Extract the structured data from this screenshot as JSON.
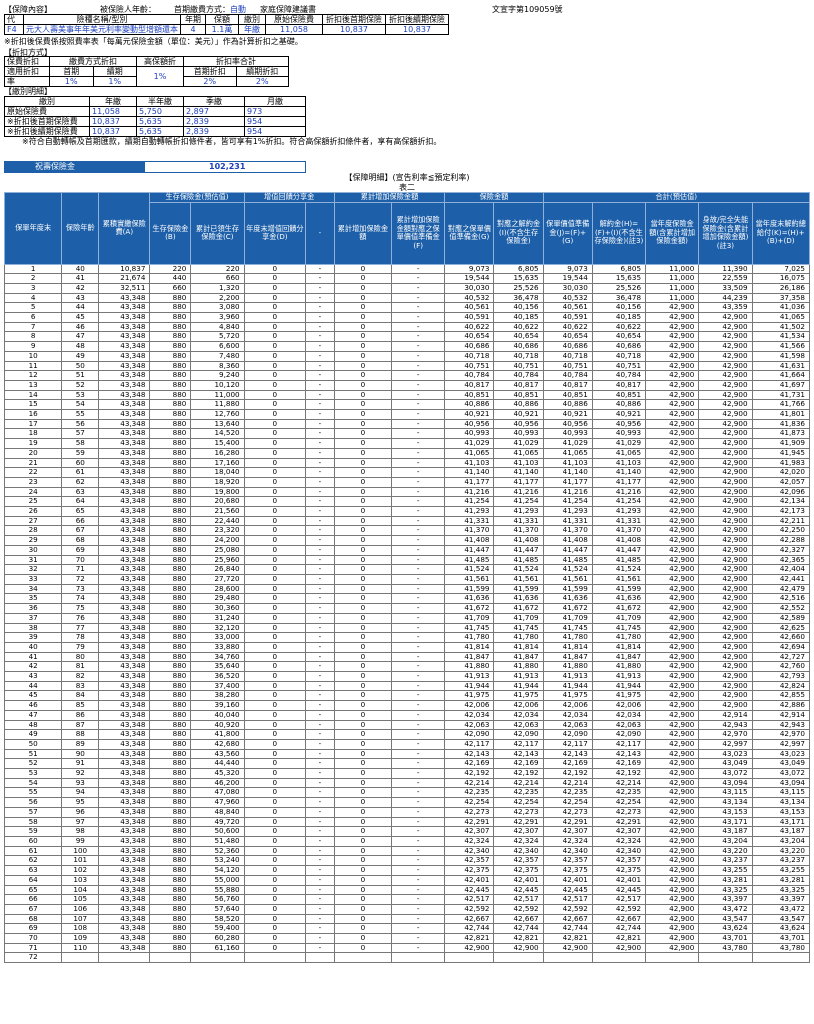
{
  "header": {
    "section_label": "【保障內容】",
    "insured_age_label": "被保險人年齡：",
    "payment_method_label": "首期繳費方式：",
    "payment_method_value": "自動",
    "doc_title": "家庭保障建議書",
    "doc_no": "文宣字第109059號"
  },
  "product_table": {
    "columns": [
      "代",
      "險種名稱/型別",
      "年期",
      "保額",
      "繳別",
      "原始保險費",
      "折扣後首期保險",
      "折扣後續期保險"
    ],
    "row": [
      "F4",
      "元大人壽美事年年美元利率變動型增額還本",
      "4",
      "1.1萬",
      "年繳",
      "11,058",
      "10,837",
      "10,837"
    ]
  },
  "note1": "※折扣後保費係按照費率表「每萬元保險金額（單位：美元）」作為計算折扣之基礎。",
  "discount": {
    "section_label": "【折扣方式】",
    "h_premium": "保費折扣",
    "h_payment": "繳費方式折扣",
    "h_high": "高保額折",
    "h_total": "折扣率合計",
    "r_applicable": "適用折扣",
    "r_rate": "率",
    "first_label": "首期",
    "renew_label": "續期",
    "high_value": "1%",
    "total_first_label": "首期折扣",
    "total_renew_label": "續期折扣",
    "first_value": "1%",
    "renew_value": "1%",
    "total_first_value": "2%",
    "total_renew_value": "2%"
  },
  "payment_detail": {
    "section_label": "【繳別明細】",
    "columns": [
      "繳別",
      "年繳",
      "半年繳",
      "季繳",
      "月繳"
    ],
    "rows": [
      [
        "原始保險費",
        "11,058",
        "5,750",
        "2,897",
        "973"
      ],
      [
        "※折扣後首期保險費",
        "10,837",
        "5,635",
        "2,839",
        "954"
      ],
      [
        "※折扣後續期保險費",
        "10,837",
        "5,635",
        "2,839",
        "954"
      ]
    ]
  },
  "note2": "※符合自動轉帳及首期匯款，續期自動轉帳折扣條件者，皆可享有1%折扣。符合高保額折扣條件者，享有高保額折扣。",
  "celebration": {
    "label": "祝壽保險金",
    "value": "102,231"
  },
  "table_title": "【保障明細】(宣告利率≦預定利率)",
  "table_subtitle": "表二",
  "group_headers": {
    "survival": "生存保險金(預估值)",
    "increase": "增值回饋分享金",
    "cumulative": "累計增加保險金額",
    "insurance": "保險金額",
    "total": "合計(預估值)"
  },
  "columns": [
    "保單年度末",
    "保險年齡",
    "累積實繳保險費(A)",
    "生存保險金(B)",
    "累計已領生存保險金(C)",
    "年度末增值回饋分享金(D)",
    "-",
    "累計增加保險金額",
    "累計增加保險金額對應之保單價值準備金(F)",
    "對應之保單價值準備金(G)",
    "對應之解約金(I)(不含生存保險金)",
    "保單價值準備金(J)=(F)+(G)",
    "解約金(H)=(F)+(I)(不含生存保險金)(註3)",
    "當年度保險金額(含累計增加保險金額)",
    "身故/完全失能保險金(含累計增加保險金額)(註3)",
    "當年度末解約總給付(K)=(H)+(B)+(D)"
  ],
  "rows": [
    [
      1,
      40,
      "10,837",
      220,
      220,
      0,
      0,
      "9,073",
      "6,805",
      "9,073",
      "6,805",
      "11,000",
      "11,390",
      "7,025"
    ],
    [
      2,
      41,
      "21,674",
      440,
      660,
      0,
      0,
      "19,544",
      "15,635",
      "19,544",
      "15,635",
      "11,000",
      "22,559",
      "16,075"
    ],
    [
      3,
      42,
      "32,511",
      660,
      "1,320",
      0,
      0,
      "30,030",
      "25,526",
      "30,030",
      "25,526",
      "11,000",
      "33,509",
      "26,186"
    ],
    [
      4,
      43,
      "43,348",
      880,
      "2,200",
      0,
      0,
      "40,532",
      "36,478",
      "40,532",
      "36,478",
      "11,000",
      "44,239",
      "37,358"
    ],
    [
      5,
      44,
      "43,348",
      880,
      "3,080",
      0,
      0,
      "40,561",
      "40,156",
      "40,561",
      "40,156",
      "42,900",
      "43,359",
      "41,036"
    ],
    [
      6,
      45,
      "43,348",
      880,
      "3,960",
      0,
      0,
      "40,591",
      "40,185",
      "40,591",
      "40,185",
      "42,900",
      "42,900",
      "41,065"
    ],
    [
      7,
      46,
      "43,348",
      880,
      "4,840",
      0,
      0,
      "40,622",
      "40,622",
      "40,622",
      "40,622",
      "42,900",
      "42,900",
      "41,502"
    ],
    [
      8,
      47,
      "43,348",
      880,
      "5,720",
      0,
      0,
      "40,654",
      "40,654",
      "40,654",
      "40,654",
      "42,900",
      "42,900",
      "41,534"
    ],
    [
      9,
      48,
      "43,348",
      880,
      "6,600",
      0,
      0,
      "40,686",
      "40,686",
      "40,686",
      "40,686",
      "42,900",
      "42,900",
      "41,566"
    ],
    [
      10,
      49,
      "43,348",
      880,
      "7,480",
      0,
      0,
      "40,718",
      "40,718",
      "40,718",
      "40,718",
      "42,900",
      "42,900",
      "41,598"
    ],
    [
      11,
      50,
      "43,348",
      880,
      "8,360",
      0,
      0,
      "40,751",
      "40,751",
      "40,751",
      "40,751",
      "42,900",
      "42,900",
      "41,631"
    ],
    [
      12,
      51,
      "43,348",
      880,
      "9,240",
      0,
      0,
      "40,784",
      "40,784",
      "40,784",
      "40,784",
      "42,900",
      "42,900",
      "41,664"
    ],
    [
      13,
      52,
      "43,348",
      880,
      "10,120",
      0,
      0,
      "40,817",
      "40,817",
      "40,817",
      "40,817",
      "42,900",
      "42,900",
      "41,697"
    ],
    [
      14,
      53,
      "43,348",
      880,
      "11,000",
      0,
      0,
      "40,851",
      "40,851",
      "40,851",
      "40,851",
      "42,900",
      "42,900",
      "41,731"
    ],
    [
      15,
      54,
      "43,348",
      880,
      "11,880",
      0,
      0,
      "40,886",
      "40,886",
      "40,886",
      "40,886",
      "42,900",
      "42,900",
      "41,766"
    ],
    [
      16,
      55,
      "43,348",
      880,
      "12,760",
      0,
      0,
      "40,921",
      "40,921",
      "40,921",
      "40,921",
      "42,900",
      "42,900",
      "41,801"
    ],
    [
      17,
      56,
      "43,348",
      880,
      "13,640",
      0,
      0,
      "40,956",
      "40,956",
      "40,956",
      "40,956",
      "42,900",
      "42,900",
      "41,836"
    ],
    [
      18,
      57,
      "43,348",
      880,
      "14,520",
      0,
      0,
      "40,993",
      "40,993",
      "40,993",
      "40,993",
      "42,900",
      "42,900",
      "41,873"
    ],
    [
      19,
      58,
      "43,348",
      880,
      "15,400",
      0,
      0,
      "41,029",
      "41,029",
      "41,029",
      "41,029",
      "42,900",
      "42,900",
      "41,909"
    ],
    [
      20,
      59,
      "43,348",
      880,
      "16,280",
      0,
      0,
      "41,065",
      "41,065",
      "41,065",
      "41,065",
      "42,900",
      "42,900",
      "41,945"
    ],
    [
      21,
      60,
      "43,348",
      880,
      "17,160",
      0,
      0,
      "41,103",
      "41,103",
      "41,103",
      "41,103",
      "42,900",
      "42,900",
      "41,983"
    ],
    [
      22,
      61,
      "43,348",
      880,
      "18,040",
      0,
      0,
      "41,140",
      "41,140",
      "41,140",
      "41,140",
      "42,900",
      "42,900",
      "42,020"
    ],
    [
      23,
      62,
      "43,348",
      880,
      "18,920",
      0,
      0,
      "41,177",
      "41,177",
      "41,177",
      "41,177",
      "42,900",
      "42,900",
      "42,057"
    ],
    [
      24,
      63,
      "43,348",
      880,
      "19,800",
      0,
      0,
      "41,216",
      "41,216",
      "41,216",
      "41,216",
      "42,900",
      "42,900",
      "42,096"
    ],
    [
      25,
      64,
      "43,348",
      880,
      "20,680",
      0,
      0,
      "41,254",
      "41,254",
      "41,254",
      "41,254",
      "42,900",
      "42,900",
      "42,134"
    ],
    [
      26,
      65,
      "43,348",
      880,
      "21,560",
      0,
      0,
      "41,293",
      "41,293",
      "41,293",
      "41,293",
      "42,900",
      "42,900",
      "42,173"
    ],
    [
      27,
      66,
      "43,348",
      880,
      "22,440",
      0,
      0,
      "41,331",
      "41,331",
      "41,331",
      "41,331",
      "42,900",
      "42,900",
      "42,211"
    ],
    [
      28,
      67,
      "43,348",
      880,
      "23,320",
      0,
      0,
      "41,370",
      "41,370",
      "41,370",
      "41,370",
      "42,900",
      "42,900",
      "42,250"
    ],
    [
      29,
      68,
      "43,348",
      880,
      "24,200",
      0,
      0,
      "41,408",
      "41,408",
      "41,408",
      "41,408",
      "42,900",
      "42,900",
      "42,288"
    ],
    [
      30,
      69,
      "43,348",
      880,
      "25,080",
      0,
      0,
      "41,447",
      "41,447",
      "41,447",
      "41,447",
      "42,900",
      "42,900",
      "42,327"
    ],
    [
      31,
      70,
      "43,348",
      880,
      "25,960",
      0,
      0,
      "41,485",
      "41,485",
      "41,485",
      "41,485",
      "42,900",
      "42,900",
      "42,365"
    ],
    [
      32,
      71,
      "43,348",
      880,
      "26,840",
      0,
      0,
      "41,524",
      "41,524",
      "41,524",
      "41,524",
      "42,900",
      "42,900",
      "42,404"
    ],
    [
      33,
      72,
      "43,348",
      880,
      "27,720",
      0,
      0,
      "41,561",
      "41,561",
      "41,561",
      "41,561",
      "42,900",
      "42,900",
      "42,441"
    ],
    [
      34,
      73,
      "43,348",
      880,
      "28,600",
      0,
      0,
      "41,599",
      "41,599",
      "41,599",
      "41,599",
      "42,900",
      "42,900",
      "42,479"
    ],
    [
      35,
      74,
      "43,348",
      880,
      "29,480",
      0,
      0,
      "41,636",
      "41,636",
      "41,636",
      "41,636",
      "42,900",
      "42,900",
      "42,516"
    ],
    [
      36,
      75,
      "43,348",
      880,
      "30,360",
      0,
      0,
      "41,672",
      "41,672",
      "41,672",
      "41,672",
      "42,900",
      "42,900",
      "42,552"
    ],
    [
      37,
      76,
      "43,348",
      880,
      "31,240",
      0,
      0,
      "41,709",
      "41,709",
      "41,709",
      "41,709",
      "42,900",
      "42,900",
      "42,589"
    ],
    [
      38,
      77,
      "43,348",
      880,
      "32,120",
      0,
      0,
      "41,745",
      "41,745",
      "41,745",
      "41,745",
      "42,900",
      "42,900",
      "42,625"
    ],
    [
      39,
      78,
      "43,348",
      880,
      "33,000",
      0,
      0,
      "41,780",
      "41,780",
      "41,780",
      "41,780",
      "42,900",
      "42,900",
      "42,660"
    ],
    [
      40,
      79,
      "43,348",
      880,
      "33,880",
      0,
      0,
      "41,814",
      "41,814",
      "41,814",
      "41,814",
      "42,900",
      "42,900",
      "42,694"
    ],
    [
      41,
      80,
      "43,348",
      880,
      "34,760",
      0,
      0,
      "41,847",
      "41,847",
      "41,847",
      "41,847",
      "42,900",
      "42,900",
      "42,727"
    ],
    [
      42,
      81,
      "43,348",
      880,
      "35,640",
      0,
      0,
      "41,880",
      "41,880",
      "41,880",
      "41,880",
      "42,900",
      "42,900",
      "42,760"
    ],
    [
      43,
      82,
      "43,348",
      880,
      "36,520",
      0,
      0,
      "41,913",
      "41,913",
      "41,913",
      "41,913",
      "42,900",
      "42,900",
      "42,793"
    ],
    [
      44,
      83,
      "43,348",
      880,
      "37,400",
      0,
      0,
      "41,944",
      "41,944",
      "41,944",
      "41,944",
      "42,900",
      "42,900",
      "42,824"
    ],
    [
      45,
      84,
      "43,348",
      880,
      "38,280",
      0,
      0,
      "41,975",
      "41,975",
      "41,975",
      "41,975",
      "42,900",
      "42,900",
      "42,855"
    ],
    [
      46,
      85,
      "43,348",
      880,
      "39,160",
      0,
      0,
      "42,006",
      "42,006",
      "42,006",
      "42,006",
      "42,900",
      "42,900",
      "42,886"
    ],
    [
      47,
      86,
      "43,348",
      880,
      "40,040",
      0,
      0,
      "42,034",
      "42,034",
      "42,034",
      "42,034",
      "42,900",
      "42,914",
      "42,914"
    ],
    [
      48,
      87,
      "43,348",
      880,
      "40,920",
      0,
      0,
      "42,063",
      "42,063",
      "42,063",
      "42,063",
      "42,900",
      "42,943",
      "42,943"
    ],
    [
      49,
      88,
      "43,348",
      880,
      "41,800",
      0,
      0,
      "42,090",
      "42,090",
      "42,090",
      "42,090",
      "42,900",
      "42,970",
      "42,970"
    ],
    [
      50,
      89,
      "43,348",
      880,
      "42,680",
      0,
      0,
      "42,117",
      "42,117",
      "42,117",
      "42,117",
      "42,900",
      "42,997",
      "42,997"
    ],
    [
      51,
      90,
      "43,348",
      880,
      "43,560",
      0,
      0,
      "42,143",
      "42,143",
      "42,143",
      "42,143",
      "42,900",
      "43,023",
      "43,023"
    ],
    [
      52,
      91,
      "43,348",
      880,
      "44,440",
      0,
      0,
      "42,169",
      "42,169",
      "42,169",
      "42,169",
      "42,900",
      "43,049",
      "43,049"
    ],
    [
      53,
      92,
      "43,348",
      880,
      "45,320",
      0,
      0,
      "42,192",
      "42,192",
      "42,192",
      "42,192",
      "42,900",
      "43,072",
      "43,072"
    ],
    [
      54,
      93,
      "43,348",
      880,
      "46,200",
      0,
      0,
      "42,214",
      "42,214",
      "42,214",
      "42,214",
      "42,900",
      "43,094",
      "43,094"
    ],
    [
      55,
      94,
      "43,348",
      880,
      "47,080",
      0,
      0,
      "42,235",
      "42,235",
      "42,235",
      "42,235",
      "42,900",
      "43,115",
      "43,115"
    ],
    [
      56,
      95,
      "43,348",
      880,
      "47,960",
      0,
      0,
      "42,254",
      "42,254",
      "42,254",
      "42,254",
      "42,900",
      "43,134",
      "43,134"
    ],
    [
      57,
      96,
      "43,348",
      880,
      "48,840",
      0,
      0,
      "42,273",
      "42,273",
      "42,273",
      "42,273",
      "42,900",
      "43,153",
      "43,153"
    ],
    [
      58,
      97,
      "43,348",
      880,
      "49,720",
      0,
      0,
      "42,291",
      "42,291",
      "42,291",
      "42,291",
      "42,900",
      "43,171",
      "43,171"
    ],
    [
      59,
      98,
      "43,348",
      880,
      "50,600",
      0,
      0,
      "42,307",
      "42,307",
      "42,307",
      "42,307",
      "42,900",
      "43,187",
      "43,187"
    ],
    [
      60,
      99,
      "43,348",
      880,
      "51,480",
      0,
      0,
      "42,324",
      "42,324",
      "42,324",
      "42,324",
      "42,900",
      "43,204",
      "43,204"
    ],
    [
      61,
      100,
      "43,348",
      880,
      "52,360",
      0,
      0,
      "42,340",
      "42,340",
      "42,340",
      "42,340",
      "42,900",
      "43,220",
      "43,220"
    ],
    [
      62,
      101,
      "43,348",
      880,
      "53,240",
      0,
      0,
      "42,357",
      "42,357",
      "42,357",
      "42,357",
      "42,900",
      "43,237",
      "43,237"
    ],
    [
      63,
      102,
      "43,348",
      880,
      "54,120",
      0,
      0,
      "42,375",
      "42,375",
      "42,375",
      "42,375",
      "42,900",
      "43,255",
      "43,255"
    ],
    [
      64,
      103,
      "43,348",
      880,
      "55,000",
      0,
      0,
      "42,401",
      "42,401",
      "42,401",
      "42,401",
      "42,900",
      "43,281",
      "43,281"
    ],
    [
      65,
      104,
      "43,348",
      880,
      "55,880",
      0,
      0,
      "42,445",
      "42,445",
      "42,445",
      "42,445",
      "42,900",
      "43,325",
      "43,325"
    ],
    [
      66,
      105,
      "43,348",
      880,
      "56,760",
      0,
      0,
      "42,517",
      "42,517",
      "42,517",
      "42,517",
      "42,900",
      "43,397",
      "43,397"
    ],
    [
      67,
      106,
      "43,348",
      880,
      "57,640",
      0,
      0,
      "42,592",
      "42,592",
      "42,592",
      "42,592",
      "42,900",
      "43,472",
      "43,472"
    ],
    [
      68,
      107,
      "43,348",
      880,
      "58,520",
      0,
      0,
      "42,667",
      "42,667",
      "42,667",
      "42,667",
      "42,900",
      "43,547",
      "43,547"
    ],
    [
      69,
      108,
      "43,348",
      880,
      "59,400",
      0,
      0,
      "42,744",
      "42,744",
      "42,744",
      "42,744",
      "42,900",
      "43,624",
      "43,624"
    ],
    [
      70,
      109,
      "43,348",
      880,
      "60,280",
      0,
      0,
      "42,821",
      "42,821",
      "42,821",
      "42,821",
      "42,900",
      "43,701",
      "43,701"
    ],
    [
      71,
      110,
      "43,348",
      880,
      "61,160",
      0,
      0,
      "42,900",
      "42,900",
      "42,900",
      "42,900",
      "42,900",
      "43,780",
      "43,780"
    ],
    [
      72,
      "",
      "",
      "",
      "",
      "",
      "",
      "",
      "",
      "",
      "",
      "",
      "",
      ""
    ]
  ]
}
